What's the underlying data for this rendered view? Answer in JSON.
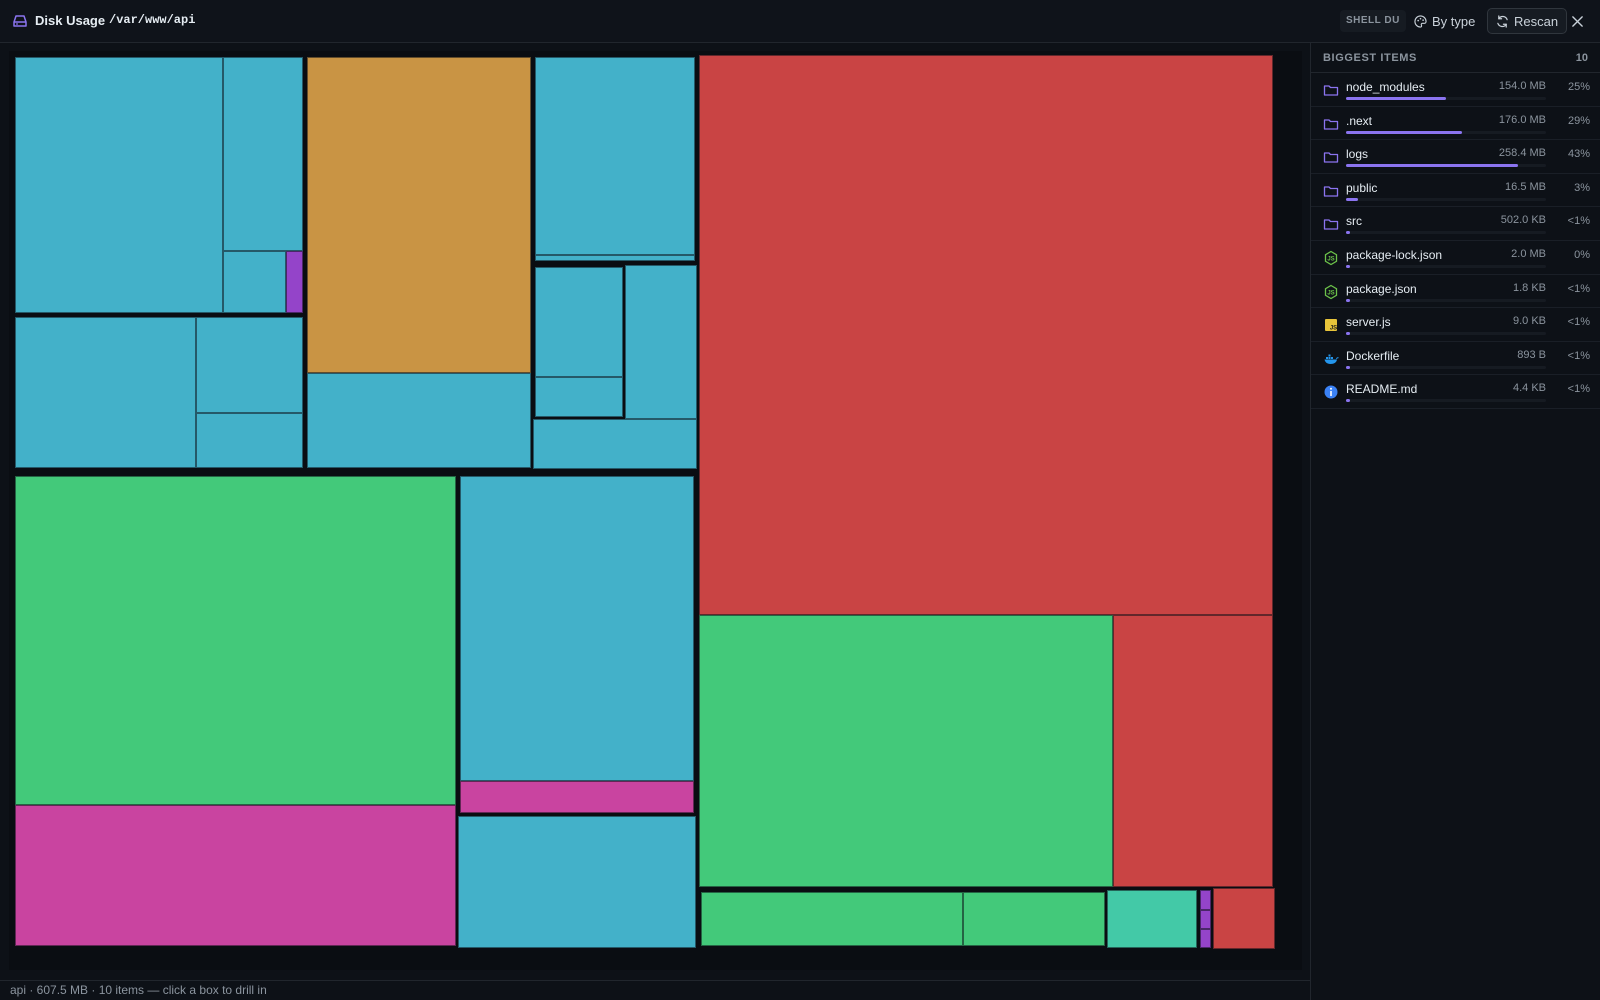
{
  "header": {
    "title": "Disk Usage",
    "path": "/var/www/api",
    "badge": "SHELL DU",
    "by_type_label": "By type",
    "rescan_label": "Rescan"
  },
  "sidebar": {
    "title": "BIGGEST ITEMS",
    "count": "10",
    "items": [
      {
        "name": "node_modules",
        "size": "154.0 MB",
        "pct": "25%",
        "fill": 0.25,
        "icon": "folder-icon"
      },
      {
        "name": ".next",
        "size": "176.0 MB",
        "pct": "29%",
        "fill": 0.29,
        "icon": "folder-icon"
      },
      {
        "name": "logs",
        "size": "258.4 MB",
        "pct": "43%",
        "fill": 0.43,
        "icon": "folder-icon"
      },
      {
        "name": "public",
        "size": "16.5 MB",
        "pct": "3%",
        "fill": 0.03,
        "icon": "folder-icon"
      },
      {
        "name": "src",
        "size": "502.0 KB",
        "pct": "<1%",
        "fill": 0.005,
        "icon": "folder-icon"
      },
      {
        "name": "package-lock.json",
        "size": "2.0 MB",
        "pct": "0%",
        "fill": 0.003,
        "icon": "nodejs-icon"
      },
      {
        "name": "package.json",
        "size": "1.8 KB",
        "pct": "<1%",
        "fill": 0.001,
        "icon": "nodejs-icon"
      },
      {
        "name": "server.js",
        "size": "9.0 KB",
        "pct": "<1%",
        "fill": 0.001,
        "icon": "javascript-icon"
      },
      {
        "name": "Dockerfile",
        "size": "893 B",
        "pct": "<1%",
        "fill": 0.001,
        "icon": "docker-icon"
      },
      {
        "name": "README.md",
        "size": "4.4 KB",
        "pct": "<1%",
        "fill": 0.001,
        "icon": "info-icon"
      }
    ]
  },
  "status": {
    "text": "api · 607.5 MB · 10 items — click a box to drill in"
  },
  "colors": {
    "accent": "#8b74f0",
    "cyan": "#43b1c9",
    "red": "#c94444",
    "green": "#43c97a",
    "magenta": "#c944a0",
    "orange": "#c99444",
    "purple": "#9444c9",
    "teal": "#43c9a7"
  }
}
